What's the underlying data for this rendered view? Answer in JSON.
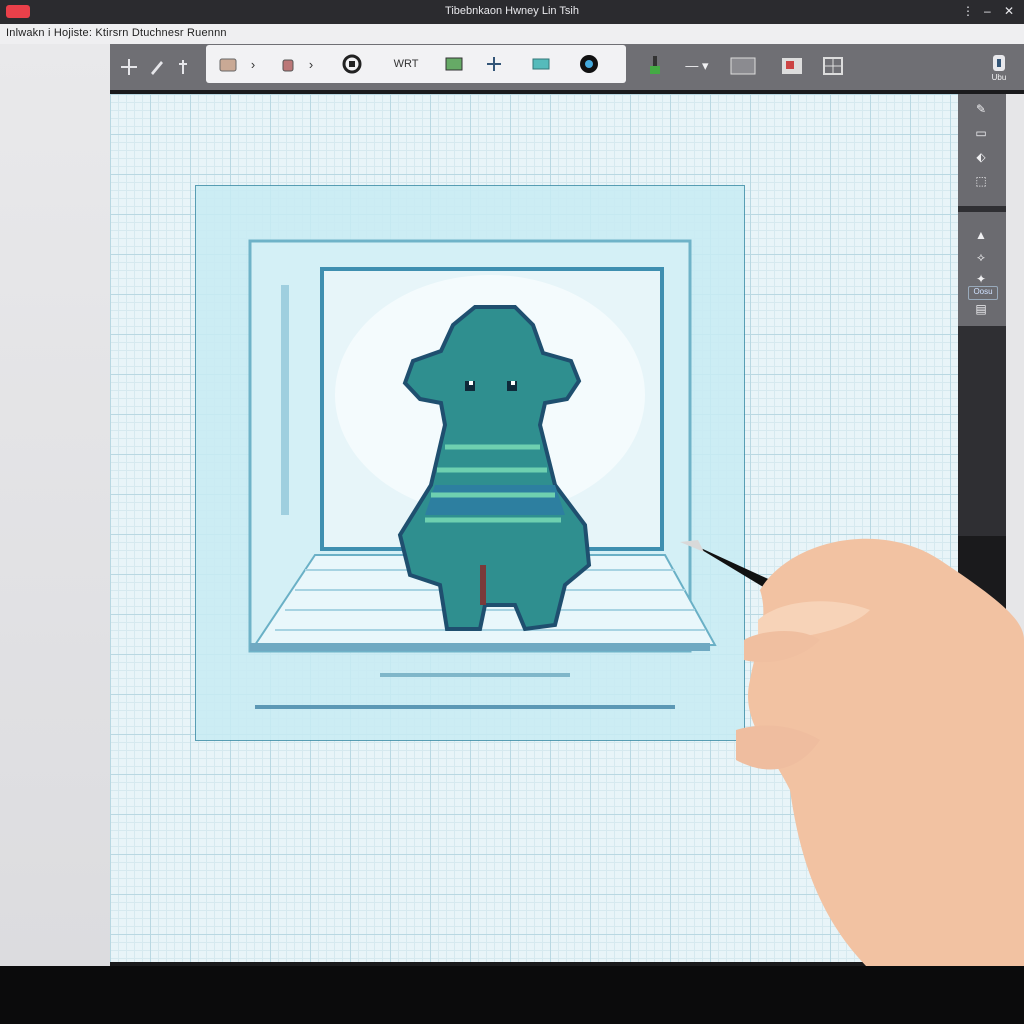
{
  "window": {
    "title": "Tibebnkaon Hwney Lin Tsih"
  },
  "menubar": {
    "text": "Inlwakn i Hojiste: Ktirsrn Dtuchnesr Ruennn"
  },
  "toolbar": {
    "tools": [
      {
        "name": "move-tool",
        "icon": "move-icon"
      },
      {
        "name": "pen-tool",
        "icon": "pen-icon"
      },
      {
        "name": "pin-tool",
        "icon": "pin-icon"
      }
    ],
    "group": {
      "text_tool_label": "WRT",
      "items": [
        "stamp-icon",
        "bucket-icon",
        "lasso-icon",
        "wrt-label",
        "image-icon",
        "transform-icon",
        "layer-icon",
        "color-icon"
      ]
    },
    "right_tools": [
      "brush-icon",
      "line-style-icon",
      "frame-icon",
      "grid-icon",
      "canvas-icon"
    ],
    "account_label": "Ubu"
  },
  "right_panel": {
    "items": [
      "pencil-icon",
      "eraser-icon",
      "fill-icon",
      "select-icon",
      "bucket-small-icon",
      "eyedrop-icon",
      "settings-icon",
      "layers-icon"
    ],
    "label": "Oosu"
  },
  "colors": {
    "titlebar": "#2b2b2f",
    "toolbar": "#6f6f74",
    "canvas": "#e8f4f8",
    "accent_red": "#e9404a",
    "art_teal": "#2f8f8f",
    "art_blue": "#2d6f9a"
  }
}
